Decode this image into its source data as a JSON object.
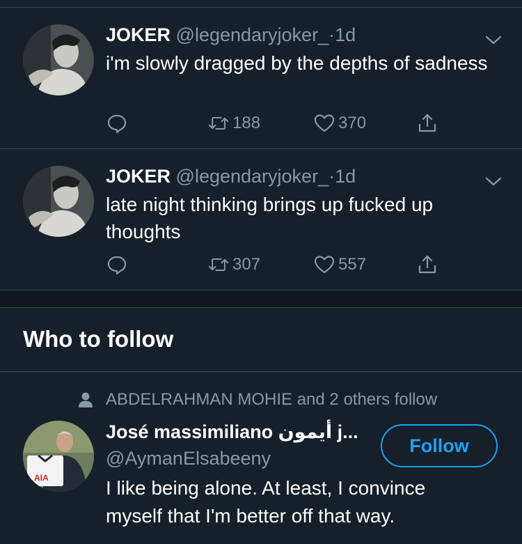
{
  "tweets": [
    {
      "name": "JOKER",
      "handle": "@legendaryjoker_",
      "separator": "·",
      "time": "1d",
      "text": "i'm slowly dragged by the depths of sadness",
      "retweets": "188",
      "likes": "370"
    },
    {
      "name": "JOKER",
      "handle": "@legendaryjoker_",
      "separator": "·",
      "time": "1d",
      "text": "late night thinking brings up fucked up thoughts",
      "retweets": "307",
      "likes": "557"
    }
  ],
  "who_to_follow": {
    "title": "Who to follow",
    "social_context": "ABDELRAHMAN MOHIE and 2 others follow",
    "suggestion": {
      "name": "José massimiliano أيمون j...",
      "handle": "@AymanElsabeeny",
      "bio": "I like being alone. At least, I convince myself that I'm better off that way.",
      "follow_label": "Follow",
      "avatar_jersey_text": "AIA"
    }
  },
  "colors": {
    "background": "#15202b",
    "divider": "#38444d",
    "muted_text": "#8899a6",
    "accent": "#1da1f2"
  },
  "icons": [
    "chevron-down-icon",
    "reply-icon",
    "retweet-icon",
    "like-icon",
    "share-icon",
    "person-icon"
  ]
}
